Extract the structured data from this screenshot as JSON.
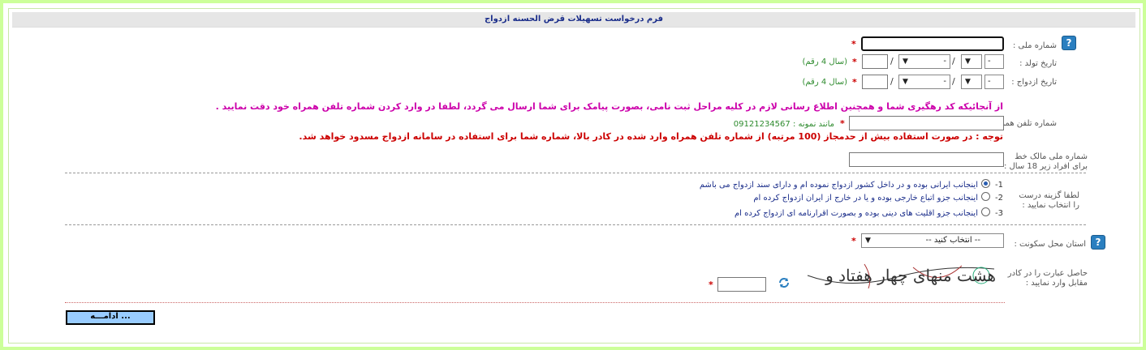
{
  "form": {
    "title": "فرم درخواست تسهیلات قرض الحسنه ازدواج"
  },
  "fields": {
    "national_id_label": "شماره ملی :",
    "birth_date_label": "تاریخ تولد :",
    "marriage_date_label": "تاریخ ازدواج :",
    "year_hint": "(سال 4 رقم)",
    "day_placeholder": "-",
    "month_placeholder": "-",
    "mobile_label": "شماره تلفن همراه :",
    "mobile_example": "مانند نمونه : 09121234567",
    "owner_id_label_line1": "شماره ملی مالک خط",
    "owner_id_label_line2": "برای افراد زیر 18 سال :",
    "option_label_line1": "لطفا گزینه درست",
    "option_label_line2": "را انتخاب نمایید :",
    "province_label": "استان محل سکونت :",
    "province_selected": "-- انتخاب کنید --",
    "captcha_label_line1": "حاصل عبارت را در کادر",
    "captcha_label_line2": "مقابل وارد نمایید :",
    "captcha_text": "هشت منهای چهار هفتاد و",
    "continue_button": "ادامـــه ..."
  },
  "messages": {
    "tracking_notice": "از آنجائیکه کد رهگیری شما و همچنین اطلاع رسانی لازم در کلیه مراحل ثبت نامی، بصورت پیامک برای شما ارسال می گردد، لطفا در وارد کردن شماره تلفن همراه خود دقت نمایید .",
    "abuse_warning": "توجه : در صورت استفاده بیش از حدمجاز (100 مرتبه) از شماره تلفن همراه وارد شده در کادر بالا، شماره شما برای استفاده در سامانه ازدواج مسدود خواهد شد."
  },
  "options": [
    {
      "num": "-1",
      "text": "اینجانب ایرانی بوده و در داخل کشور ازدواج نموده ام و دارای سند ازدواج می باشم",
      "selected": true
    },
    {
      "num": "-2",
      "text": "اینجانب جزو اتباع خارجی بوده و یا در خارج از ایران ازدواج کرده ام",
      "selected": false
    },
    {
      "num": "-3",
      "text": "اینجانب جزو اقلیت های دینی بوده و بصورت اقرارنامه ای ازدواج کرده ام",
      "selected": false
    }
  ],
  "symbols": {
    "star": "*",
    "slash": "/",
    "help": "?",
    "refresh_icon": "refresh-icon"
  },
  "colors": {
    "frame_green": "#ccff99",
    "title_blue": "#1a2d8a",
    "required_red": "#cc0000",
    "notice_magenta": "#cc00aa",
    "hint_green": "#2e8b2e",
    "button_blue": "#99ccff"
  }
}
